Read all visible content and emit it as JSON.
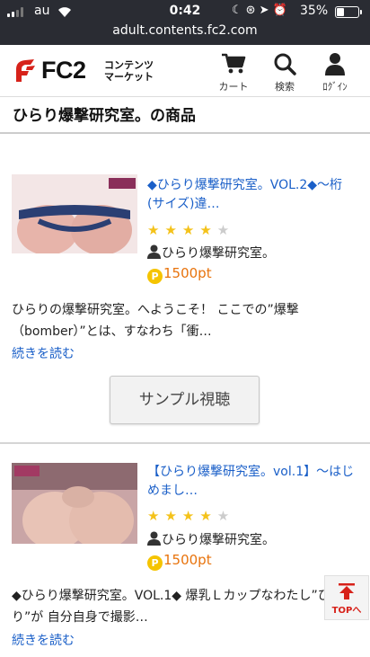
{
  "status_bar": {
    "carrier": "au",
    "time": "0:42",
    "icons": [
      "moon-icon",
      "orientation-lock-icon",
      "location-icon",
      "alarm-icon"
    ],
    "battery": "35%"
  },
  "browser": {
    "url": "adult.contents.fc2.com"
  },
  "header": {
    "logo_text": "FC2",
    "logo_sub_line1": "コンテンツ",
    "logo_sub_line2": "マーケット",
    "cart_label": "カート",
    "search_label": "検索",
    "login_label": "ﾛｸﾞｲﾝ"
  },
  "page_title": "ひらり爆撃研究室。の商品",
  "products": [
    {
      "title": "◆ひらり爆撃研究室。VOL.2◆〜桁(サイズ)違…",
      "rating": 4,
      "seller": "ひらり爆撃研究室。",
      "price": "1500pt",
      "description": "ひらりの爆撃研究室。へようこそ！ ここでの”爆撃（bomber）”とは、すなわち「衝…",
      "read_more": "続きを読む",
      "sample_button": "サンプル視聴"
    },
    {
      "title": "【ひらり爆撃研究室。vol.1】〜はじめまし…",
      "rating": 4,
      "seller": "ひらり爆撃研究室。",
      "price": "1500pt",
      "description": "◆ひらり爆撃研究室。VOL.1◆ 爆乳Ｌカップなわたし”ひらり”が 自分自身で撮影…",
      "read_more": "続きを読む"
    }
  ],
  "top_button": "TOPへ",
  "colors": {
    "link": "#1a5fc8",
    "price": "#e8730c",
    "star": "#f4c21a",
    "brand_red": "#d7221a"
  }
}
